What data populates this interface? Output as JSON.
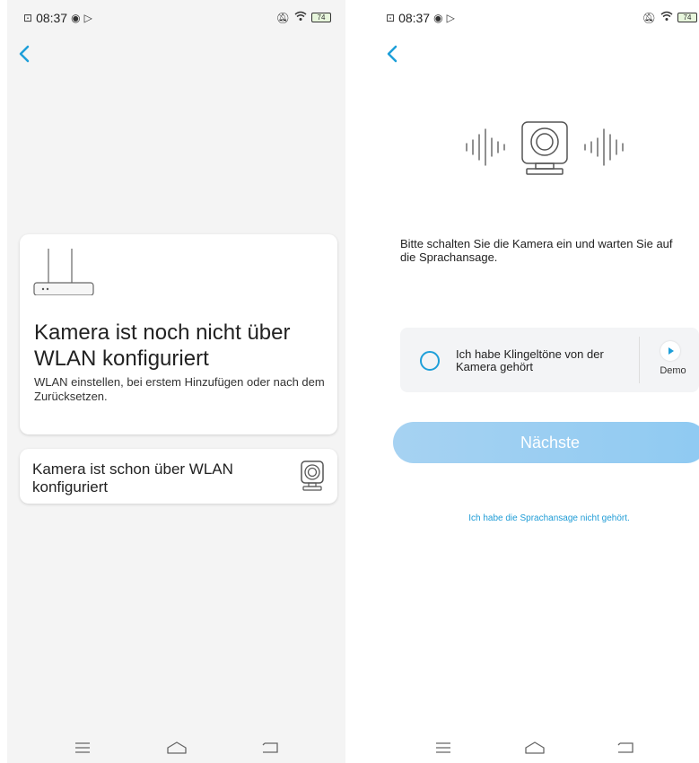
{
  "left": {
    "status": {
      "time": "08:37",
      "battery": "74"
    },
    "option_not_configured": {
      "title": "Kamera ist noch nicht über WLAN konfiguriert",
      "description": "WLAN einstellen, bei erstem Hinzufügen oder nach dem Zurücksetzen."
    },
    "option_configured": {
      "title": "Kamera ist schon über WLAN konfiguriert"
    }
  },
  "right": {
    "status": {
      "time": "08:37",
      "battery": "74"
    },
    "instruction": "Bitte schalten Sie die Kamera ein und warten Sie auf die Sprachansage.",
    "confirm_label": "Ich habe Klingeltöne von der Kamera gehört",
    "demo_label": "Demo",
    "next_button": "Nächste",
    "not_heard_link": "Ich habe die Sprachansage nicht gehört."
  },
  "colors": {
    "accent": "#1e9fd9",
    "button_gradient_start": "#a6d2f2",
    "button_gradient_end": "#8fcaf2",
    "left_background": "#f4f4f4"
  },
  "icons": [
    "back-chevron-icon",
    "router-icon",
    "camera-icon",
    "sound-wave-icon",
    "play-icon",
    "menu-icon",
    "home-icon",
    "return-icon",
    "wifi-icon",
    "mute-icon",
    "battery-icon"
  ]
}
